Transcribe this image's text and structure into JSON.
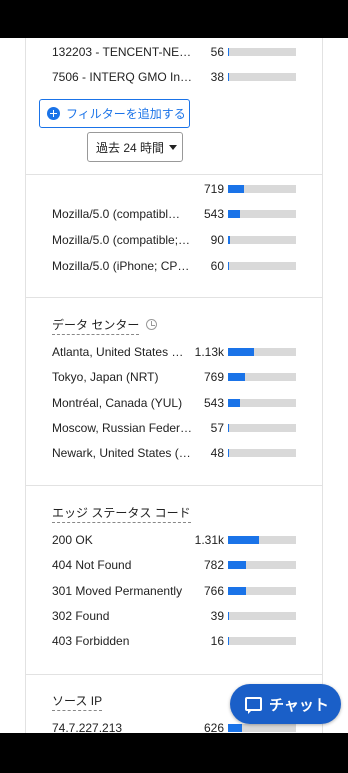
{
  "asn_rows": [
    {
      "label": "132203 - TENCENT-NE…",
      "count": "56",
      "fraction": 0.02
    },
    {
      "label": "7506 - INTERQ GMO Int…",
      "count": "38",
      "fraction": 0.02
    }
  ],
  "filter_button_label": "フィルターを追加する",
  "time_select_label": "過去 24 時間",
  "user_agent_rows": [
    {
      "label": "",
      "count": "719",
      "fraction": 0.24
    },
    {
      "label": "Mozilla/5.0 (compatibl…",
      "count": "543",
      "fraction": 0.17
    },
    {
      "label": "Mozilla/5.0 (compatible;…",
      "count": "90",
      "fraction": 0.03
    },
    {
      "label": "Mozilla/5.0 (iPhone; CP…",
      "count": "60",
      "fraction": 0.02
    }
  ],
  "data_center": {
    "title": "データ センター",
    "rows": [
      {
        "label": "Atlanta, United States …",
        "count": "1.13k",
        "fraction": 0.38
      },
      {
        "label": "Tokyo, Japan (NRT)",
        "count": "769",
        "fraction": 0.25
      },
      {
        "label": "Montréal, Canada (YUL)",
        "count": "543",
        "fraction": 0.17
      },
      {
        "label": "Moscow, Russian Feder…",
        "count": "57",
        "fraction": 0.02
      },
      {
        "label": "Newark, United States (…",
        "count": "48",
        "fraction": 0.02
      }
    ]
  },
  "edge_status": {
    "title": "エッジ ステータス コード",
    "rows": [
      {
        "label": "200 OK",
        "count": "1.31k",
        "fraction": 0.45
      },
      {
        "label": "404 Not Found",
        "count": "782",
        "fraction": 0.27
      },
      {
        "label": "301 Moved Permanently",
        "count": "766",
        "fraction": 0.26
      },
      {
        "label": "302 Found",
        "count": "39",
        "fraction": 0.02
      },
      {
        "label": "403 Forbidden",
        "count": "16",
        "fraction": 0.01
      }
    ]
  },
  "source_ip": {
    "title": "ソース IP",
    "rows": [
      {
        "label": "74.7.227.213",
        "count": "626",
        "fraction": 0.2
      }
    ]
  },
  "chat_button_label": "チャット",
  "colors": {
    "accent": "#1a73e8",
    "chat": "#1a5fc8",
    "track": "#d9d9d9"
  }
}
